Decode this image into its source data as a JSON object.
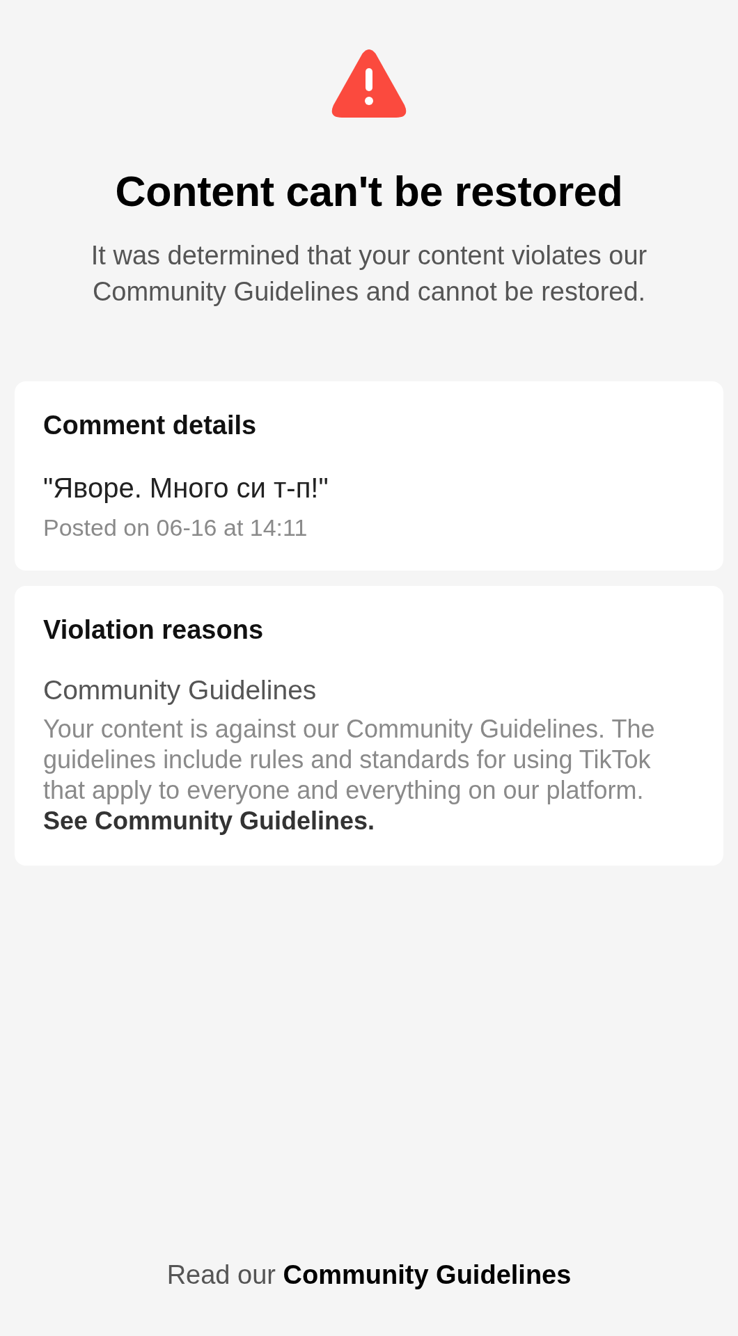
{
  "header": {
    "title": "Content can't be restored",
    "description": "It was determined that your content violates our Community Guidelines and cannot be restored."
  },
  "comment_details": {
    "title": "Comment details",
    "comment": "\"Яворе. Много си т-п!\"",
    "posted": "Posted on 06-16 at 14:11"
  },
  "violation_reasons": {
    "title": "Violation reasons",
    "reason": "Community Guidelines",
    "description": "Your content is against our Community Guidelines. The guidelines include rules and standards for using TikTok that apply to everyone and everything on our platform.",
    "link": "See Community Guidelines."
  },
  "footer": {
    "text": "Read our",
    "link": "Community Guidelines"
  }
}
